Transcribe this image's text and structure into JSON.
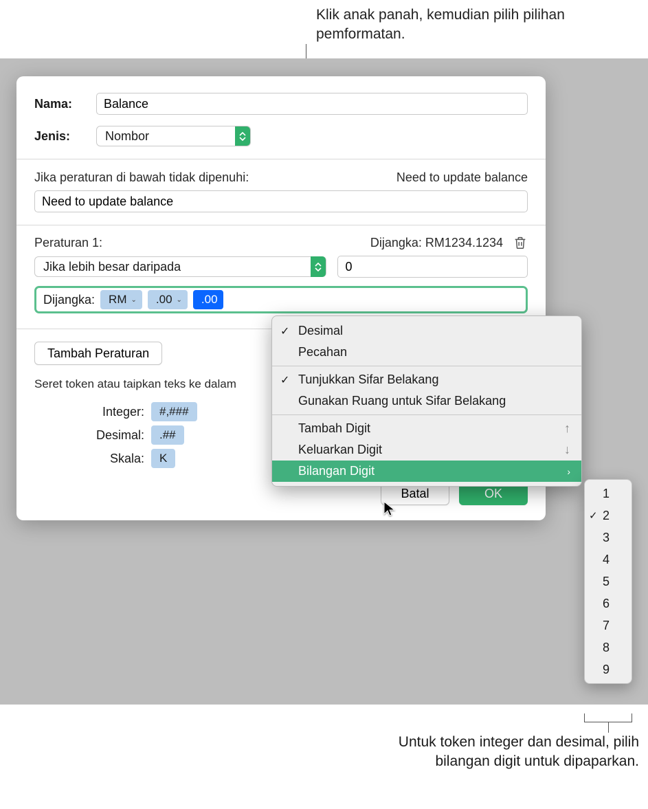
{
  "callout_top": "Klik anak panah, kemudian pilih pilihan pemformatan.",
  "callout_bottom": "Untuk token integer dan desimal, pilih bilangan digit untuk dipaparkan.",
  "dialog": {
    "name_label": "Nama:",
    "name_value": "Balance",
    "type_label": "Jenis:",
    "type_value": "Nombor",
    "rule_fallback_label": "Jika peraturan di bawah tidak dipenuhi:",
    "rule_fallback_preview": "Need to update balance",
    "rule_fallback_value": "Need to update balance",
    "rule1_label": "Peraturan 1:",
    "rule1_preview": "Dijangka: RM1234.1234",
    "rule1_condition": "Jika lebih besar daripada",
    "rule1_value": "0",
    "format_label": "Dijangka:",
    "tokens": {
      "rm": "RM",
      "dec1": ".00",
      "dec2": ".00"
    },
    "add_rule": "Tambah Peraturan",
    "drag_hint": "Seret token atau taipkan teks ke dalam",
    "token_examples": {
      "integer_label": "Integer:",
      "integer_value": "#,###",
      "decimal_label": "Desimal:",
      "decimal_value": ".##",
      "scale_label": "Skala:",
      "scale_value": "K"
    },
    "cancel": "Batal",
    "ok": "OK"
  },
  "popup": {
    "decimal": "Desimal",
    "fraction": "Pecahan",
    "trailing_zeros": "Tunjukkan Sifar Belakang",
    "space_trailing": "Gunakan Ruang untuk Sifar Belakang",
    "add_digit": "Tambah Digit",
    "remove_digit": "Keluarkan Digit",
    "digit_count": "Bilangan Digit"
  },
  "submenu": {
    "items": [
      "1",
      "2",
      "3",
      "4",
      "5",
      "6",
      "7",
      "8",
      "9"
    ],
    "selected": "2"
  }
}
